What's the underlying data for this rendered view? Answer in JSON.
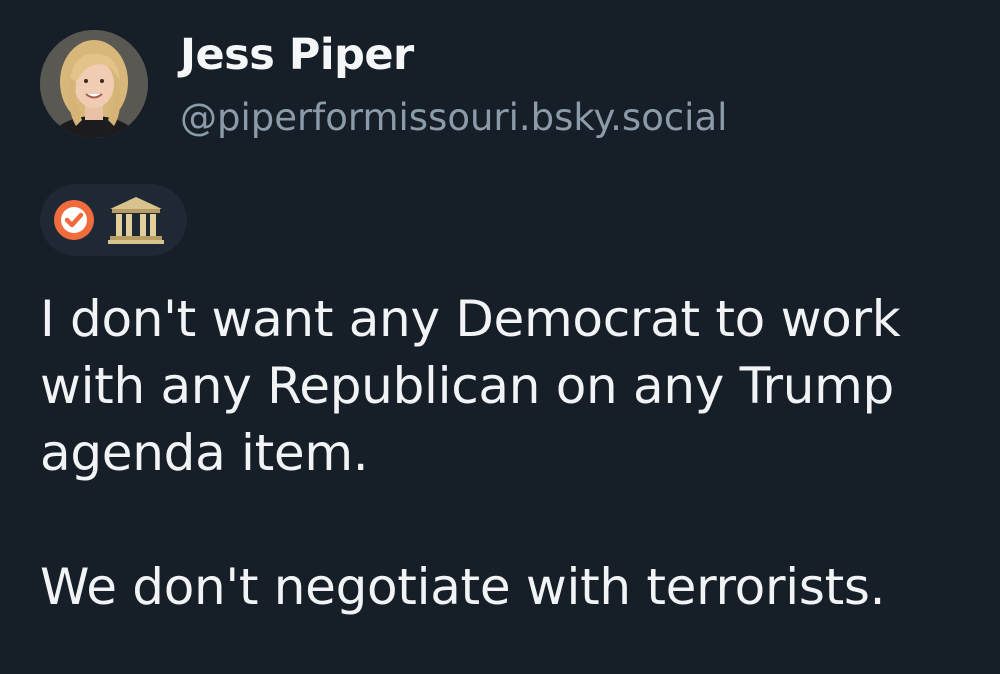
{
  "author": {
    "name": "Jess Piper",
    "handle": "@piperformissouri.bsky.social",
    "avatar_icon": "profile-photo"
  },
  "badges": [
    {
      "icon": "verified-check-icon",
      "color": "#f06c3c"
    },
    {
      "icon": "government-building-icon",
      "color": "#c9b27a"
    }
  ],
  "post": {
    "lines": [
      "I don't want any Democrat to work",
      "with any Republican on any Trump",
      "agenda item.",
      "",
      "We don't negotiate with terrorists."
    ]
  },
  "colors": {
    "background": "#161e27",
    "text": "#f1f3f5",
    "handle": "#8c9ba9",
    "badge_pill": "#1e2935"
  }
}
